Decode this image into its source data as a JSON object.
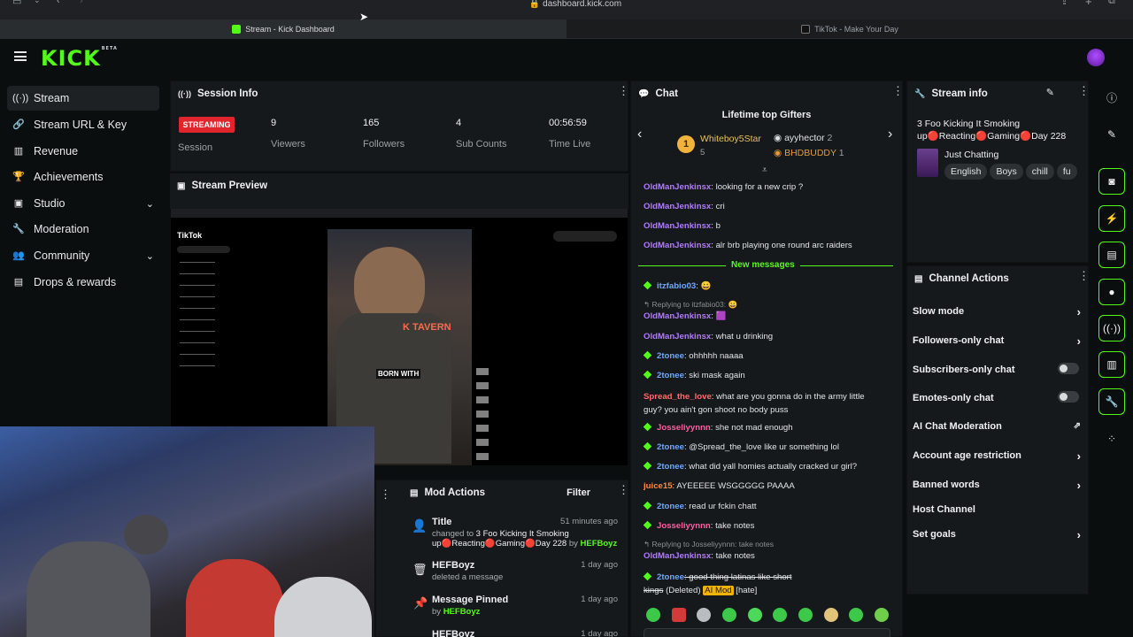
{
  "browser": {
    "url": "dashboard.kick.com",
    "tabs": [
      {
        "label": "Stream - Kick Dashboard",
        "active": true
      },
      {
        "label": "TikTok - Make Your Day",
        "active": false
      }
    ]
  },
  "app": {
    "logo": "KICK",
    "logo_badge": "BETA"
  },
  "sidebar": {
    "items": [
      {
        "label": "Stream",
        "icon": "stream-icon",
        "active": true
      },
      {
        "label": "Stream URL & Key",
        "icon": "link-icon"
      },
      {
        "label": "Revenue",
        "icon": "chart-icon"
      },
      {
        "label": "Achievements",
        "icon": "trophy-icon"
      },
      {
        "label": "Studio",
        "icon": "layout-icon",
        "expandable": true
      },
      {
        "label": "Moderation",
        "icon": "wrench-icon"
      },
      {
        "label": "Community",
        "icon": "users-icon",
        "expandable": true
      },
      {
        "label": "Drops & rewards",
        "icon": "gift-icon"
      }
    ]
  },
  "session": {
    "title": "Session Info",
    "status": "STREAMING",
    "status_label": "Session",
    "stats": [
      {
        "value": "9",
        "label": "Viewers"
      },
      {
        "value": "165",
        "label": "Followers"
      },
      {
        "value": "4",
        "label": "Sub Counts"
      },
      {
        "value": "00:56:59",
        "label": "Time Live"
      }
    ]
  },
  "preview": {
    "title": "Stream Preview",
    "video_caption": "BORN WITH",
    "sign_text": "K TAVERN",
    "tiktok_logo": "TikTok"
  },
  "mod_actions": {
    "title": "Mod Actions",
    "filter_label": "Filter",
    "items": [
      {
        "title": "Title",
        "detail_prefix": "changed to ",
        "detail_value": "3 Foo Kicking It Smoking up🔴Reacting🔴Gaming🔴Day 228",
        "detail_by": " by ",
        "user": "HEFBoyz",
        "time": "51 minutes ago",
        "icon": "user-edit-icon"
      },
      {
        "title": "HEFBoyz",
        "detail_prefix": "deleted a message",
        "time": "1 day ago",
        "icon": "trash-icon"
      },
      {
        "title": "Message Pinned",
        "detail_prefix": "by ",
        "user": "HEFBoyz",
        "time": "1 day ago",
        "icon": "pin-icon"
      },
      {
        "title": "HEFBoyz",
        "time": "1 day ago",
        "icon": "trash-icon"
      }
    ]
  },
  "chat": {
    "title": "Chat",
    "gifters_title": "Lifetime top Gifters",
    "gifters": [
      {
        "rank": "1",
        "name": "Whiteboy5Star",
        "count": "5"
      },
      {
        "name": "ayyhector",
        "count": "2"
      },
      {
        "name": "BHDBUDDY",
        "count": "1"
      }
    ],
    "new_messages": "New messages",
    "messages": [
      {
        "user": "OldManJenkinsx",
        "text": ": looking for a new crip ?",
        "color": "#b07cff"
      },
      {
        "user": "OldManJenkinsx",
        "text": ": cri",
        "color": "#b07cff"
      },
      {
        "user": "OldManJenkinsx",
        "text": ": b",
        "color": "#b07cff"
      },
      {
        "user": "OldManJenkinsx",
        "text": ": alr brb playing one round arc raiders",
        "color": "#b07cff"
      },
      {
        "user": "itzfabio03",
        "text": ":",
        "color": "#6ea8ff",
        "badge": true
      },
      {
        "reply": "Replying to itzfabio03:"
      },
      {
        "user": "OldManJenkinsx",
        "text": ":",
        "color": "#b07cff"
      },
      {
        "user": "OldManJenkinsx",
        "text": ": what u drinking",
        "color": "#b07cff"
      },
      {
        "user": "2tonee",
        "text": ": ohhhhh naaaa",
        "color": "#6ea8ff",
        "badge": true
      },
      {
        "user": "2tonee",
        "text": ": ski mask again",
        "color": "#6ea8ff",
        "badge": true
      },
      {
        "user": "Spread_the_love",
        "text": ": what are you gonna do in the army little",
        "text2": "guy? you ain't gon shoot no body puss",
        "color": "#ff6a6a"
      },
      {
        "user": "Josseliyynnn",
        "text": ": she not mad enough",
        "color": "#ff5fa2",
        "badge": true
      },
      {
        "user": "2tonee",
        "text": ": @Spread_the_love like ur something lol",
        "color": "#6ea8ff",
        "badge": true
      },
      {
        "user": "2tonee",
        "text": ": what did yall homies actually cracked ur girl?",
        "color": "#6ea8ff",
        "badge": true
      },
      {
        "user": "juice15",
        "text": ": AYEEEEE WSGGGGG PAAAA",
        "color": "#ff8a3c"
      },
      {
        "user": "2tonee",
        "text": ": read ur fckin chatt",
        "color": "#6ea8ff",
        "badge": true
      },
      {
        "user": "Josseliyynnn",
        "text": ": take notes",
        "color": "#ff5fa2",
        "badge": true
      },
      {
        "reply": "Replying to Josseliyynnn: take notes"
      },
      {
        "user": "OldManJenkinsx",
        "text": ": take notes",
        "color": "#b07cff"
      },
      {
        "user": "2tonee",
        "text": ": good thing latinas like short",
        "text2": "kings",
        "deleted": "(Deleted)",
        "aimod": "AI Mod",
        "hate": "[hate]",
        "color": "#6ea8ff",
        "badge": true
      }
    ]
  },
  "stream_info": {
    "title": "Stream info",
    "stream_title": "3 Foo Kicking It Smoking up🔴Reacting🔴Gaming🔴Day 228",
    "category": "Just Chatting",
    "tags": [
      "English",
      "Boys",
      "chill",
      "fu"
    ]
  },
  "channel_actions": {
    "title": "Channel Actions",
    "items": [
      {
        "label": "Slow mode",
        "control": "chevron"
      },
      {
        "label": "Followers-only chat",
        "control": "chevron"
      },
      {
        "label": "Subscribers-only chat",
        "control": "toggle",
        "on": false
      },
      {
        "label": "Emotes-only chat",
        "control": "toggle",
        "on": false
      },
      {
        "label": "AI Chat Moderation",
        "control": "external"
      },
      {
        "label": "Account age restriction",
        "control": "chevron"
      },
      {
        "label": "Banned words",
        "control": "chevron"
      },
      {
        "label": "Host Channel",
        "control": "none"
      },
      {
        "label": "Set goals",
        "control": "chevron"
      }
    ]
  },
  "colors": {
    "brand": "#53fc18",
    "live": "#e0252d",
    "panel": "#16191b"
  }
}
